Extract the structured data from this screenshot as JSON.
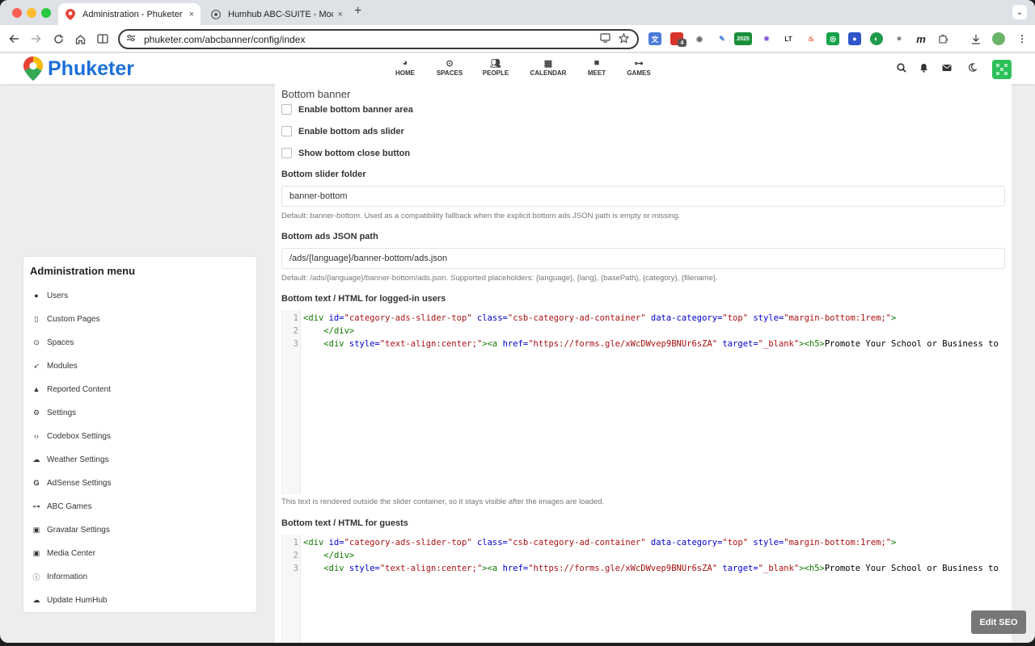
{
  "browser": {
    "tabs": [
      {
        "title": "Administration - Phuketer",
        "close": "×"
      },
      {
        "title": "Humhub ABC-SUITE - Module",
        "close": "×"
      }
    ],
    "new_tab": "+",
    "tab_menu": "⌄",
    "url": "phuketer.com/abcbanner/config/index",
    "extensions": {
      "badge_count": "4",
      "badge_2025": "2025",
      "lt": "LT",
      "m": "m"
    },
    "colors": {
      "active_tab": "#ffffff",
      "tabstrip": "#dee1e6",
      "red": "#ff5f57",
      "yellow": "#febc2e",
      "green": "#28c840"
    }
  },
  "site": {
    "brand": "Phuketer",
    "brand_color": "#1e6fd9",
    "nav": [
      {
        "label": "HOME",
        "icon": "dashboard-icon"
      },
      {
        "label": "SPACES",
        "icon": "spaces-icon"
      },
      {
        "label": "PEOPLE",
        "icon": "people-icon"
      },
      {
        "label": "CALENDAR",
        "icon": "calendar-icon"
      },
      {
        "label": "MEET",
        "icon": "video-icon"
      },
      {
        "label": "GAMES",
        "icon": "gamepad-icon"
      }
    ]
  },
  "admin_menu": {
    "title": "Administration menu",
    "items": [
      {
        "label": "Users",
        "icon": "user-icon"
      },
      {
        "label": "Custom Pages",
        "icon": "file-icon"
      },
      {
        "label": "Spaces",
        "icon": "dot-circle-icon"
      },
      {
        "label": "Modules",
        "icon": "rocket-icon"
      },
      {
        "label": "Reported Content",
        "icon": "warning-icon"
      },
      {
        "label": "Settings",
        "icon": "cogs-icon"
      },
      {
        "label": "Codebox Settings",
        "icon": "code-icon"
      },
      {
        "label": "Weather Settings",
        "icon": "cloud-icon"
      },
      {
        "label": "AdSense Settings",
        "icon": "google-icon"
      },
      {
        "label": "ABC Games",
        "icon": "gamepad-icon"
      },
      {
        "label": "Gravatar Settings",
        "icon": "image-icon"
      },
      {
        "label": "Media Center",
        "icon": "image-icon"
      },
      {
        "label": "Information",
        "icon": "info-icon"
      },
      {
        "label": "Update HumHub",
        "icon": "cloud-upload-icon"
      }
    ]
  },
  "form": {
    "section_title": "Bottom banner",
    "checkboxes": [
      {
        "label": "Enable bottom banner area",
        "checked": false
      },
      {
        "label": "Enable bottom ads slider",
        "checked": false
      },
      {
        "label": "Show bottom close button",
        "checked": false
      }
    ],
    "slider_folder": {
      "label": "Bottom slider folder",
      "value": "banner-bottom",
      "help": "Default: banner-bottom. Used as a compatibility fallback when the explicit bottom ads JSON path is empty or missing."
    },
    "json_path": {
      "label": "Bottom ads JSON path",
      "value": "/ads/{language}/banner-bottom/ads.json",
      "help": "Default: /ads/{language}/banner-bottom/ads.json. Supported placeholders: {language}, {lang}, {basePath}, {category}, {filename}."
    },
    "logged_in": {
      "label": "Bottom text / HTML for logged-in users",
      "help": "This text is rendered outside the slider container, so it stays visible after the images are loaded."
    },
    "guests": {
      "label": "Bottom text / HTML for guests"
    },
    "code": {
      "line_numbers": [
        "1",
        "2",
        "3"
      ],
      "l1": {
        "open": "<div ",
        "id_attr": "id=",
        "id_val": "\"category-ads-slider-top\"",
        "class_attr": " class=",
        "class_val": "\"csb-category-ad-container\"",
        "dc_attr": " data-category=",
        "dc_val": "\"top\"",
        "style_attr": " style=",
        "style_val": "\"margin-bottom:1rem;\"",
        "close": ">"
      },
      "l2": {
        "indent": "    ",
        "tag": "</div>"
      },
      "l3": {
        "indent": "    ",
        "open": "<div ",
        "style_attr": "style=",
        "style_val": "\"text-align:center;\"",
        "a_open": "><a ",
        "href_attr": "href=",
        "href_val": "\"https://forms.gle/xWcDWvep9BNUr6sZA\"",
        "target_attr": " target=",
        "target_val": "\"_blank\"",
        "h5": "><h5>",
        "text": "Promote Your School or Business to"
      }
    }
  },
  "edit_seo": "Edit SEO"
}
